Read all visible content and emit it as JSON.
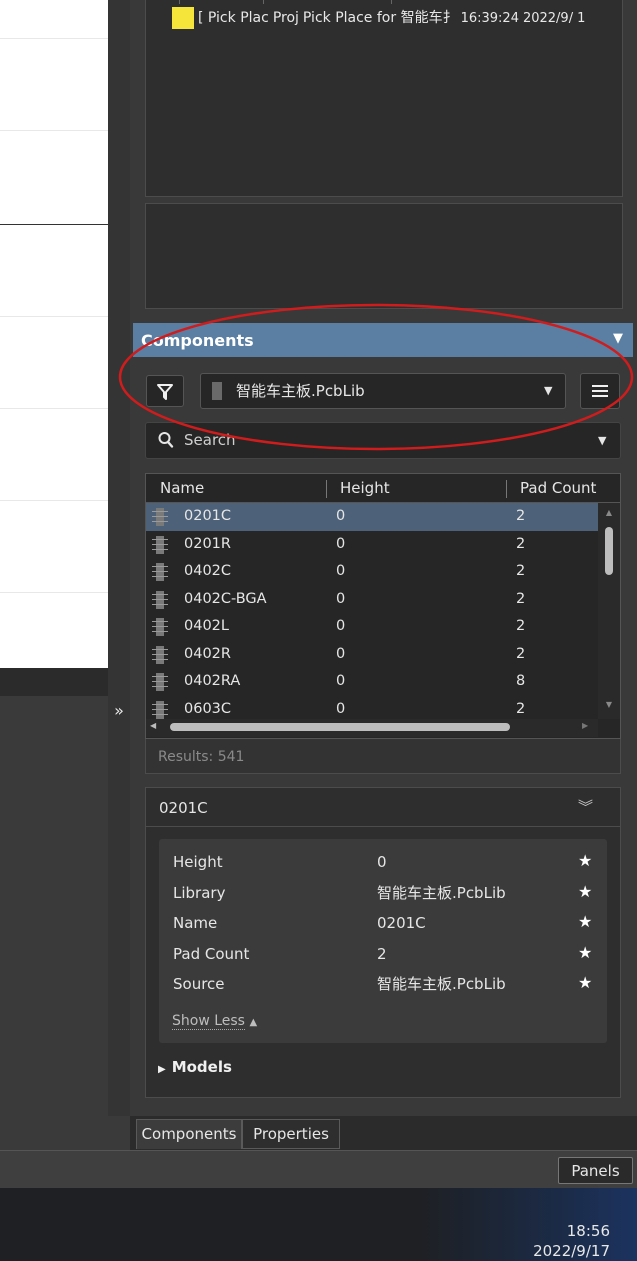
{
  "message_panel": {
    "row": {
      "col1": "[ Pick Plac",
      "col2": "Proj",
      "col3": "Pick Place for 智能车扌",
      "col4": "16:39:2⁠4",
      "col5": "2022/9/",
      "col6": "1"
    },
    "swatch_color": "#f5e53b"
  },
  "components_panel": {
    "title": "Components",
    "library": "智能车主板.PcbLib",
    "search_placeholder": "Search",
    "columns": [
      "Name",
      "Height",
      "Pad Count"
    ],
    "rows": [
      {
        "name": "0201C",
        "height": "0",
        "pad_count": "2",
        "selected": true
      },
      {
        "name": "0201R",
        "height": "0",
        "pad_count": "2"
      },
      {
        "name": "0402C",
        "height": "0",
        "pad_count": "2"
      },
      {
        "name": "0402C-BGA",
        "height": "0",
        "pad_count": "2"
      },
      {
        "name": "0402L",
        "height": "0",
        "pad_count": "2"
      },
      {
        "name": "0402R",
        "height": "0",
        "pad_count": "2"
      },
      {
        "name": "0402RA",
        "height": "0",
        "pad_count": "8"
      },
      {
        "name": "0603C",
        "height": "0",
        "pad_count": "2"
      }
    ],
    "results": "Results: 541",
    "detail": {
      "title": "0201C",
      "properties": [
        {
          "key": "Height",
          "value": "0"
        },
        {
          "key": "Library",
          "value": "智能车主板.PcbLib"
        },
        {
          "key": "Name",
          "value": "0201C"
        },
        {
          "key": "Pad Count",
          "value": "2"
        },
        {
          "key": "Source",
          "value": "智能车主板.PcbLib"
        }
      ],
      "show_less": "Show Less",
      "models": "Models"
    }
  },
  "tabs": [
    "Components",
    "Properties"
  ],
  "panels_button": "Panels",
  "clock": {
    "time": "18:56",
    "date": "2022/9/17"
  },
  "colors": {
    "header_accent": "#5a7fa3",
    "selection": "#4d6178",
    "annotation": "#d01c1c"
  }
}
